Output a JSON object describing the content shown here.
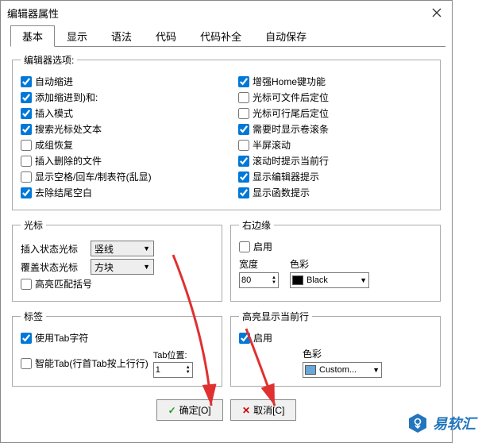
{
  "title": "编辑器属性",
  "tabs": [
    "基本",
    "显示",
    "语法",
    "代码",
    "代码补全",
    "自动保存"
  ],
  "options_legend": "编辑器选项:",
  "left": [
    "自动缩进",
    "添加缩进到)和:",
    "插入模式",
    "搜索光标处文本",
    "成组恢复",
    "插入删除的文件",
    "显示空格/回车/制表符(乱显)",
    "去除结尾空白"
  ],
  "right": [
    "增强Home键功能",
    "光标可文件后定位",
    "光标可行尾后定位",
    "需要时显示卷滚条",
    "半屏滚动",
    "滚动时提示当前行",
    "显示编辑器提示",
    "显示函数提示"
  ],
  "left_checked": [
    true,
    true,
    true,
    true,
    false,
    false,
    false,
    true
  ],
  "right_checked": [
    true,
    false,
    false,
    true,
    false,
    true,
    true,
    true
  ],
  "cursor": {
    "legend": "光标",
    "row1_label": "插入状态光标",
    "row1_val": "竖线",
    "row2_label": "覆盖状态光标",
    "row2_val": "方块",
    "chk": "高亮匹配括号"
  },
  "redge": {
    "legend": "右边缘",
    "enable": "启用",
    "width_label": "宽度",
    "width_val": "80",
    "color_label": "色彩",
    "color_val": "Black"
  },
  "tabfs": {
    "legend": "标签",
    "chk1": "使用Tab字符",
    "chk2": "智能Tab(行首Tab按上行行)",
    "pos_label": "Tab位置:",
    "pos_val": "1"
  },
  "hlrow": {
    "legend": "高亮显示当前行",
    "enable": "启用",
    "color_label": "色彩",
    "color_val": "Custom..."
  },
  "buttons": {
    "ok": "确定[O]",
    "cancel": "取消[C]"
  },
  "wm": "易软汇"
}
